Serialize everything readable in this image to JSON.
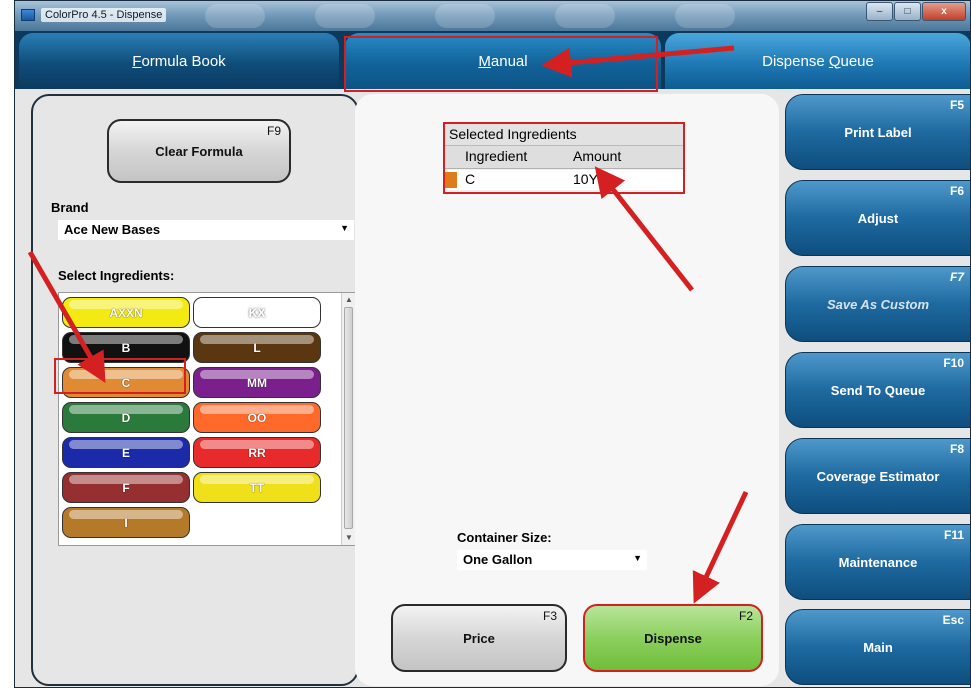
{
  "window": {
    "title": "ColorPro 4.5 - Dispense",
    "min_glyph": "–",
    "max_glyph": "□",
    "close_glyph": "x"
  },
  "tabs": {
    "formula_book": {
      "accel": "F",
      "rest": "ormula Book"
    },
    "manual": {
      "accel": "M",
      "rest": "anual"
    },
    "dispense_queue": {
      "pre": "Dispense ",
      "accel": "Q",
      "rest": "ueue"
    }
  },
  "left": {
    "clear_formula": {
      "label": "Clear Formula",
      "key": "F9"
    },
    "brand_label": "Brand",
    "brand_value": "Ace New Bases",
    "select_ingredients_label": "Select Ingredients:",
    "ingredients": [
      {
        "label": "AXXN",
        "color": "#f2ea10",
        "text_color": "#ffffff"
      },
      {
        "label": "KX",
        "color": "#ffffff",
        "text_color": "#ffffff"
      },
      {
        "label": "B",
        "color": "#111111",
        "text_color": "#ffffff"
      },
      {
        "label": "L",
        "color": "#5a3710",
        "text_color": "#ffffff"
      },
      {
        "label": "C",
        "color": "#e08a34",
        "text_color": "#ffffff"
      },
      {
        "label": "MM",
        "color": "#7a1f8c",
        "text_color": "#ffffff"
      },
      {
        "label": "D",
        "color": "#2a7a3c",
        "text_color": "#ffffff"
      },
      {
        "label": "OO",
        "color": "#ff6a2a",
        "text_color": "#ffffff"
      },
      {
        "label": "E",
        "color": "#1a2aa8",
        "text_color": "#ffffff"
      },
      {
        "label": "RR",
        "color": "#e82a2a",
        "text_color": "#ffffff"
      },
      {
        "label": "F",
        "color": "#962f2f",
        "text_color": "#ffffff"
      },
      {
        "label": "TT",
        "color": "#efe01a",
        "text_color": "#ffffff"
      },
      {
        "label": "I",
        "color": "#b47a2a",
        "text_color": "#ffffff"
      }
    ]
  },
  "center": {
    "selected_title": "Selected Ingredients",
    "col_ingredient": "Ingredient",
    "col_amount": "Amount",
    "rows": [
      {
        "ingredient": "C",
        "amount": "10Y"
      }
    ],
    "container_label": "Container Size:",
    "container_value": "One Gallon",
    "price": {
      "label": "Price",
      "key": "F3"
    },
    "dispense": {
      "label": "Dispense",
      "key": "F2"
    }
  },
  "side": [
    {
      "label": "Print Label",
      "key": "F5"
    },
    {
      "label": "Adjust",
      "key": "F6"
    },
    {
      "label": "Save As Custom",
      "key": "F7",
      "disabled": true
    },
    {
      "label": "Send To Queue",
      "key": "F10"
    },
    {
      "label": "Coverage Estimator",
      "key": "F8"
    },
    {
      "label": "Maintenance",
      "key": "F11"
    },
    {
      "label": "Main",
      "key": "Esc"
    }
  ],
  "annotation_color": "#d42020"
}
